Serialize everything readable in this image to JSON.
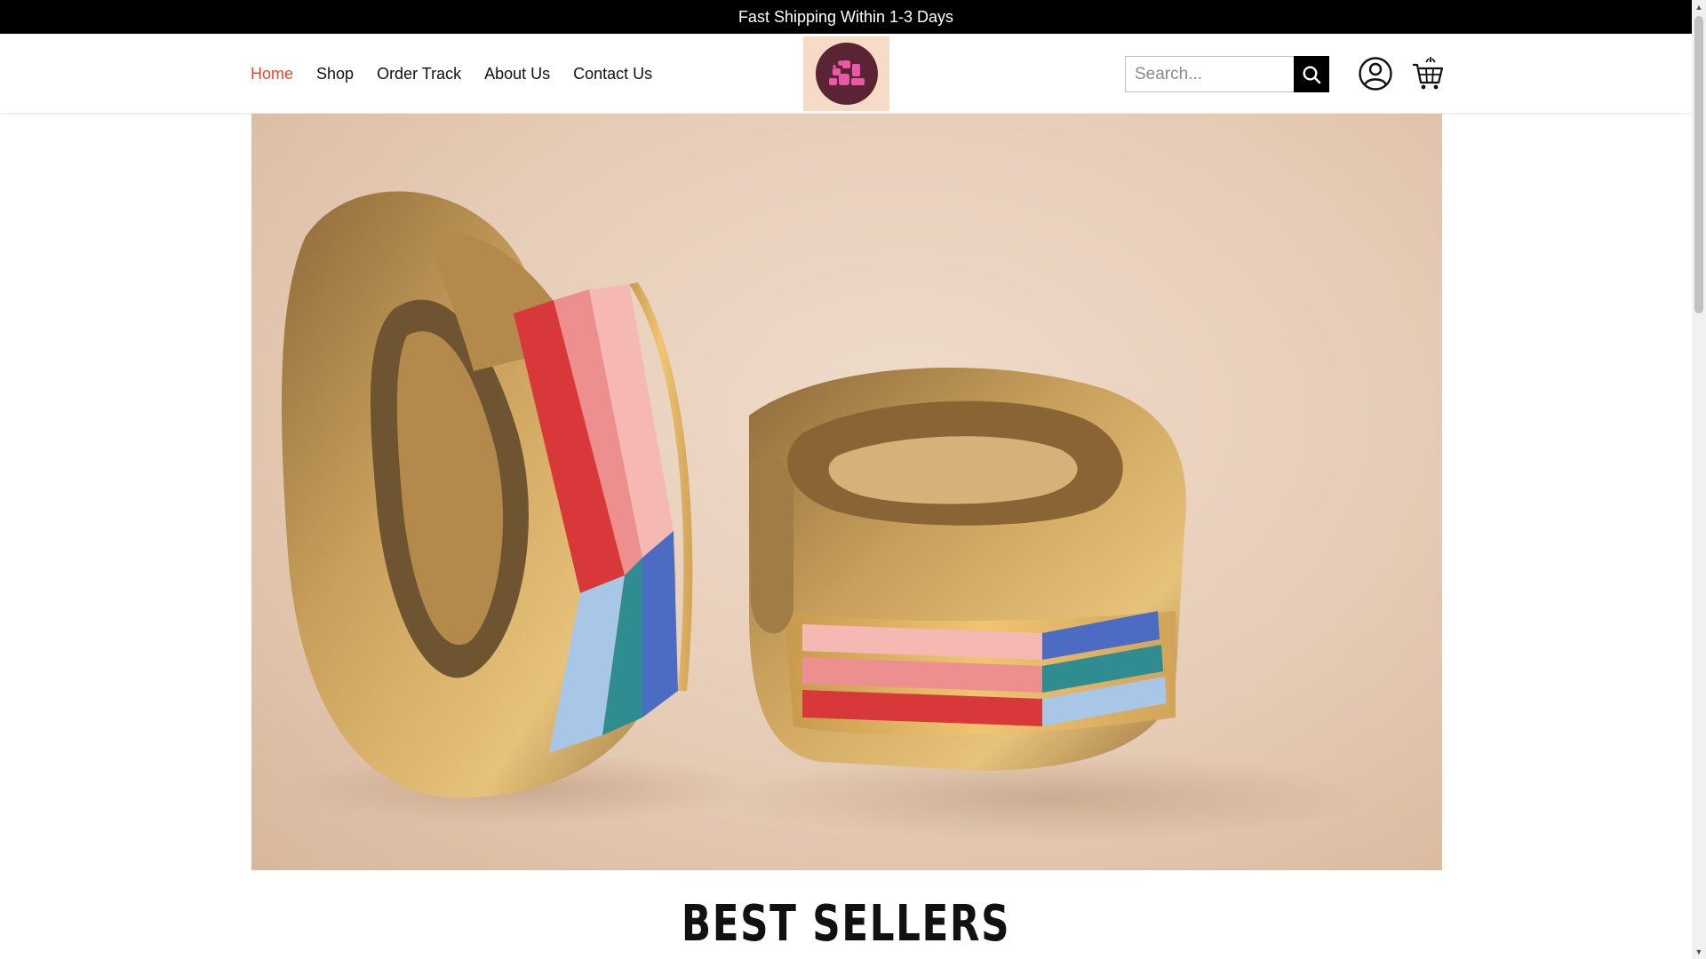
{
  "announcement": {
    "text": "Fast Shipping Within 1-3 Days"
  },
  "nav": {
    "items": [
      {
        "label": "Home",
        "active": true
      },
      {
        "label": "Shop"
      },
      {
        "label": "Order Track"
      },
      {
        "label": "About Us"
      },
      {
        "label": "Contact Us"
      }
    ]
  },
  "search": {
    "placeholder": "Search..."
  },
  "icons": {
    "search": "search-icon",
    "account": "user-icon",
    "cart": "cart-icon"
  },
  "colors": {
    "active_nav": "#e4472a",
    "announcement_bg": "#000000",
    "logo_bg": "#f6dcc7",
    "logo_circle": "#5a2434",
    "logo_mark": "#e85aa6"
  },
  "sections": {
    "best_sellers": "BEST SELLERS"
  }
}
